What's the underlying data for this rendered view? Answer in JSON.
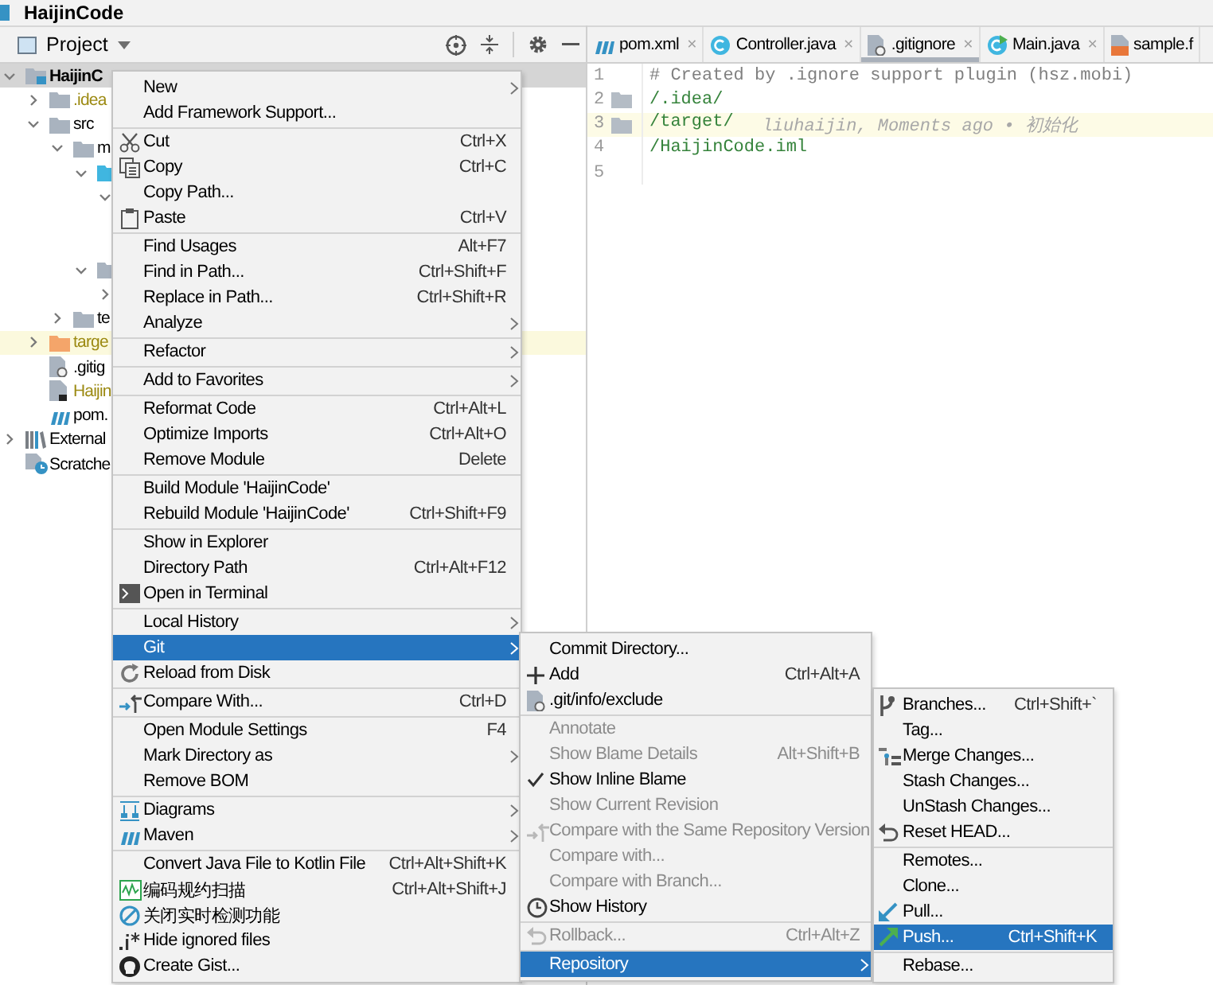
{
  "window": {
    "title": "HaijinCode"
  },
  "project_panel": {
    "title": "Project",
    "tree": [
      {
        "label": "HaijinC",
        "kind": "module",
        "expanded": true,
        "selected": true,
        "ignored": false,
        "highlighted": false,
        "children": [
          {
            "label": ".idea",
            "kind": "folder",
            "expanded": false,
            "selected": false,
            "ignored": true,
            "highlighted": false
          },
          {
            "label": "src",
            "kind": "folder",
            "expanded": true,
            "selected": false,
            "ignored": false,
            "highlighted": false,
            "children": [
              {
                "label": "m",
                "kind": "folder",
                "expanded": true,
                "selected": false,
                "ignored": false,
                "highlighted": false,
                "children": [
                  {
                    "kind": "source-folder",
                    "expanded": true,
                    "children": [
                      {
                        "expanded": true
                      }
                    ]
                  },
                  {
                    "kind": "folder",
                    "expanded": true,
                    "children": [
                      {
                        "expanded": false
                      }
                    ]
                  }
                ]
              },
              {
                "label": "te",
                "kind": "folder",
                "expanded": false,
                "selected": false,
                "ignored": false,
                "highlighted": false
              }
            ]
          },
          {
            "label": "targe",
            "kind": "excluded-folder",
            "expanded": false,
            "selected": false,
            "ignored": true,
            "highlighted": true
          },
          {
            "label": ".gitig",
            "kind": "gitignore-file",
            "selected": false,
            "ignored": false,
            "highlighted": false
          },
          {
            "label": "Haijin",
            "kind": "module-file",
            "selected": false,
            "ignored": true,
            "highlighted": false
          },
          {
            "label": "pom.",
            "kind": "maven-file",
            "selected": false,
            "ignored": false,
            "highlighted": false
          }
        ]
      },
      {
        "label": "External",
        "kind": "library",
        "expanded": false,
        "selected": false,
        "ignored": false,
        "highlighted": false
      },
      {
        "label": "Scratche",
        "kind": "scratches",
        "selected": false,
        "ignored": false,
        "highlighted": false
      }
    ]
  },
  "editor": {
    "tabs": [
      {
        "label": "pom.xml",
        "kind": "maven",
        "selected": false,
        "close": "×"
      },
      {
        "label": "Controller.java",
        "kind": "class",
        "selected": false,
        "close": "×"
      },
      {
        "label": ".gitignore",
        "kind": "gitignore",
        "selected": true,
        "close": "×"
      },
      {
        "label": "Main.java",
        "kind": "runnable-class",
        "selected": false,
        "close": "×"
      },
      {
        "label": "sample.f",
        "kind": "fxml",
        "selected": false
      }
    ],
    "lines": [
      {
        "number": "1",
        "kind": "comment",
        "text": "# Created by .ignore support plugin (hsz.mobi)",
        "folder": false,
        "current": false
      },
      {
        "number": "2",
        "kind": "entry",
        "text": "/.idea/",
        "folder": true,
        "current": false
      },
      {
        "number": "3",
        "kind": "entry",
        "text": "/target/",
        "blame": "liuhaijin, Moments ago • 初始化",
        "folder": true,
        "current": true
      },
      {
        "number": "4",
        "kind": "entry",
        "text": "/HaijinCode.iml",
        "folder": false,
        "current": false
      },
      {
        "number": "5",
        "kind": "empty",
        "folder": false,
        "current": false
      }
    ]
  },
  "menus": [
    {
      "groups": [
        [
          {
            "label": "New",
            "submenu": true,
            "selected": false
          },
          {
            "label": "Add Framework Support...",
            "submenu": false,
            "selected": false
          }
        ],
        [
          {
            "label": "Cut",
            "shortcut": "Ctrl+X",
            "submenu": false,
            "selected": false
          },
          {
            "label": "Copy",
            "shortcut": "Ctrl+C",
            "submenu": false,
            "selected": false
          },
          {
            "label": "Copy Path...",
            "submenu": false,
            "selected": false
          },
          {
            "label": "Paste",
            "shortcut": "Ctrl+V",
            "submenu": false,
            "selected": false
          }
        ],
        [
          {
            "label": "Find Usages",
            "shortcut": "Alt+F7",
            "submenu": false,
            "selected": false
          },
          {
            "label": "Find in Path...",
            "shortcut": "Ctrl+Shift+F",
            "submenu": false,
            "selected": false
          },
          {
            "label": "Replace in Path...",
            "shortcut": "Ctrl+Shift+R",
            "submenu": false,
            "selected": false
          },
          {
            "label": "Analyze",
            "submenu": true,
            "selected": false
          }
        ],
        [
          {
            "label": "Refactor",
            "submenu": true,
            "selected": false
          }
        ],
        [
          {
            "label": "Add to Favorites",
            "submenu": true,
            "selected": false
          }
        ],
        [
          {
            "label": "Reformat Code",
            "shortcut": "Ctrl+Alt+L",
            "submenu": false,
            "selected": false
          },
          {
            "label": "Optimize Imports",
            "shortcut": "Ctrl+Alt+O",
            "submenu": false,
            "selected": false
          },
          {
            "label": "Remove Module",
            "shortcut": "Delete",
            "submenu": false,
            "selected": false
          }
        ],
        [
          {
            "label": "Build Module 'HaijinCode'",
            "submenu": false,
            "selected": false
          },
          {
            "label": "Rebuild Module 'HaijinCode'",
            "shortcut": "Ctrl+Shift+F9",
            "submenu": false,
            "selected": false
          }
        ],
        [
          {
            "label": "Show in Explorer",
            "submenu": false,
            "selected": false
          },
          {
            "label": "Directory Path",
            "shortcut": "Ctrl+Alt+F12",
            "submenu": false,
            "selected": false
          },
          {
            "label": "Open in Terminal",
            "submenu": false,
            "selected": false
          }
        ],
        [
          {
            "label": "Local History",
            "submenu": true,
            "selected": false
          },
          {
            "label": "Git",
            "submenu": true,
            "selected": true
          },
          {
            "label": "Reload from Disk",
            "submenu": false,
            "selected": false
          }
        ],
        [
          {
            "label": "Compare With...",
            "shortcut": "Ctrl+D",
            "submenu": false,
            "selected": false
          }
        ],
        [
          {
            "label": "Open Module Settings",
            "shortcut": "F4",
            "submenu": false,
            "selected": false
          },
          {
            "label": "Mark Directory as",
            "submenu": true,
            "selected": false
          },
          {
            "label": "Remove BOM",
            "submenu": false,
            "selected": false
          }
        ],
        [
          {
            "label": "Diagrams",
            "submenu": true,
            "selected": false
          },
          {
            "label": "Maven",
            "submenu": true,
            "selected": false
          }
        ],
        [
          {
            "label": "Convert Java File to Kotlin File",
            "shortcut": "Ctrl+Alt+Shift+K",
            "submenu": false,
            "selected": false
          },
          {
            "label": "编码规约扫描",
            "shortcut": "Ctrl+Alt+Shift+J",
            "submenu": false,
            "selected": false
          },
          {
            "label": "关闭实时检测功能",
            "submenu": false,
            "selected": false
          },
          {
            "label": "Hide ignored files",
            "submenu": false,
            "selected": false
          },
          {
            "label": "Create Gist...",
            "submenu": false,
            "selected": false
          }
        ]
      ]
    },
    {
      "groups": [
        [
          {
            "label": "Commit Directory...",
            "submenu": false,
            "selected": false,
            "disabled": false,
            "checked": false
          },
          {
            "label": "Add",
            "shortcut": "Ctrl+Alt+A",
            "submenu": false,
            "selected": false,
            "disabled": false,
            "checked": false
          },
          {
            "label": ".git/info/exclude",
            "submenu": false,
            "selected": false,
            "disabled": false,
            "checked": false
          }
        ],
        [
          {
            "label": "Annotate",
            "submenu": false,
            "selected": false,
            "disabled": true,
            "checked": false
          },
          {
            "label": "Show Blame Details",
            "shortcut": "Alt+Shift+B",
            "submenu": false,
            "selected": false,
            "disabled": true,
            "checked": false
          },
          {
            "label": "Show Inline Blame",
            "submenu": false,
            "selected": false,
            "disabled": false,
            "checked": true
          },
          {
            "label": "Show Current Revision",
            "submenu": false,
            "selected": false,
            "disabled": true,
            "checked": false
          },
          {
            "label": "Compare with the Same Repository Version",
            "submenu": false,
            "selected": false,
            "disabled": true,
            "checked": false
          },
          {
            "label": "Compare with...",
            "submenu": false,
            "selected": false,
            "disabled": true,
            "checked": false
          },
          {
            "label": "Compare with Branch...",
            "submenu": false,
            "selected": false,
            "disabled": true,
            "checked": false
          },
          {
            "label": "Show History",
            "submenu": false,
            "selected": false,
            "disabled": false,
            "checked": false
          }
        ],
        [
          {
            "label": "Rollback...",
            "shortcut": "Ctrl+Alt+Z",
            "submenu": false,
            "selected": false,
            "disabled": true,
            "checked": false
          }
        ],
        [
          {
            "label": "Repository",
            "submenu": true,
            "selected": true,
            "disabled": false,
            "checked": false
          }
        ]
      ]
    },
    {
      "groups": [
        [
          {
            "label": "Branches...",
            "shortcut": "Ctrl+Shift+`",
            "selected": false
          },
          {
            "label": "Tag...",
            "selected": false
          },
          {
            "label": "Merge Changes...",
            "selected": false
          },
          {
            "label": "Stash Changes...",
            "selected": false
          },
          {
            "label": "UnStash Changes...",
            "selected": false
          },
          {
            "label": "Reset HEAD...",
            "selected": false
          }
        ],
        [
          {
            "label": "Remotes...",
            "selected": false
          },
          {
            "label": "Clone...",
            "selected": false
          },
          {
            "label": "Pull...",
            "selected": false
          },
          {
            "label": "Push...",
            "shortcut": "Ctrl+Shift+K",
            "selected": true
          }
        ],
        [
          {
            "label": "Rebase...",
            "selected": false
          }
        ]
      ]
    }
  ]
}
